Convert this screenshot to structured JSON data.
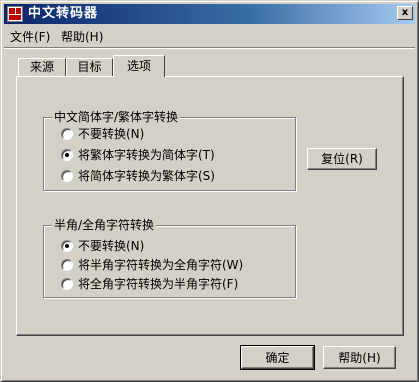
{
  "window": {
    "title": "中文转码器",
    "close_glyph": "x"
  },
  "menubar": {
    "items": [
      {
        "label": "文件(F)"
      },
      {
        "label": "帮助(H)"
      }
    ]
  },
  "tabs": [
    {
      "label": "来源",
      "active": false
    },
    {
      "label": "目标",
      "active": false
    },
    {
      "label": "选项",
      "active": true
    }
  ],
  "chinese_group": {
    "label": "中文简体字/繁体字转换",
    "options": [
      {
        "label": "不要转换(N)",
        "checked": false
      },
      {
        "label": "将繁体字转换为简体字(T)",
        "checked": true
      },
      {
        "label": "将简体字转换为繁体字(S)",
        "checked": false
      }
    ]
  },
  "width_group": {
    "label": "半角/全角字符转换",
    "options": [
      {
        "label": "不要转换(N)",
        "checked": true
      },
      {
        "label": "将半角字符转换为全角字符(W)",
        "checked": false
      },
      {
        "label": "将全角字符转换为半角字符(F)",
        "checked": false
      }
    ]
  },
  "buttons": {
    "reset": "复位(R)",
    "ok": "确定",
    "help": "帮助(H)"
  },
  "colors": {
    "face": "#d4d0c8",
    "title_start": "#0a246a",
    "title_end": "#a6caf0"
  }
}
